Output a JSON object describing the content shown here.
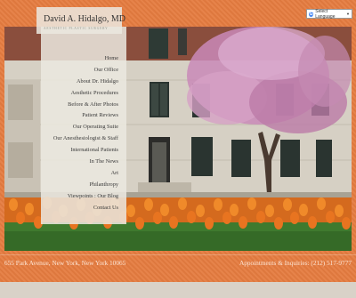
{
  "brand": {
    "name": "David A. Hidalgo, MD",
    "tagline": "AESTHETIC PLASTIC SURGERY"
  },
  "language_selector": {
    "label": "Select Language"
  },
  "nav": {
    "items": [
      "Home",
      "Our Office",
      "About Dr. Hidalgo",
      "Aesthetic Procedures",
      "Before & After Photos",
      "Patient Reviews",
      "Our Operating Suite",
      "Our Anesthesiologist & Staff",
      "International Patients",
      "In The News",
      "Art",
      "Philanthropy",
      "Viewpoints : Our Blog",
      "Contact Us"
    ]
  },
  "footer": {
    "address": "655 Park Avenue, New York, New York 10065",
    "phone": "Appointments & Inquiries: (212) 517-9777"
  },
  "colors": {
    "background": "#e57c40",
    "nav_panel": "#ebe8e0"
  }
}
